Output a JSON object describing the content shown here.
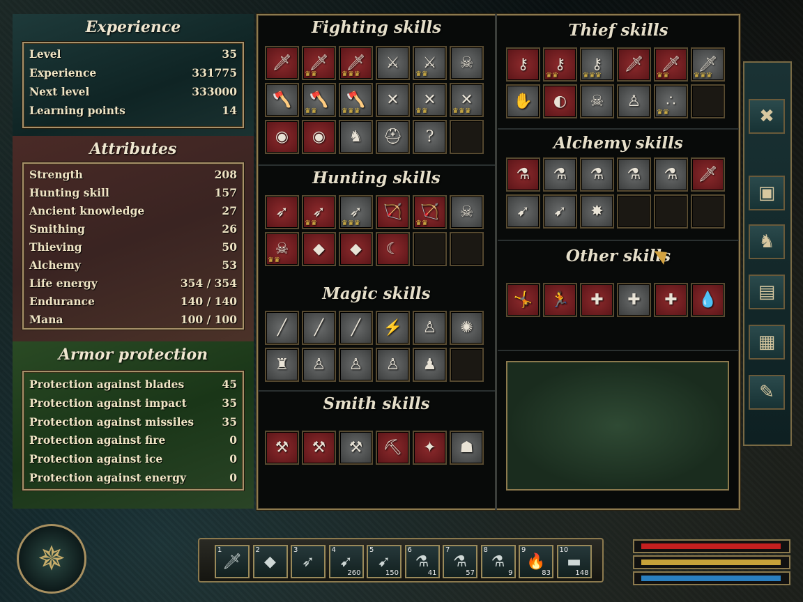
{
  "experience": {
    "title": "Experience",
    "rows": [
      {
        "label": "Level",
        "value": "35"
      },
      {
        "label": "Experience",
        "value": "331775"
      },
      {
        "label": "Next level",
        "value": "333000"
      },
      {
        "label": "Learning points",
        "value": "14"
      }
    ]
  },
  "attributes": {
    "title": "Attributes",
    "rows": [
      {
        "label": "Strength",
        "value": "208"
      },
      {
        "label": "Hunting skill",
        "value": "157"
      },
      {
        "label": "Ancient knowledge",
        "value": "27"
      },
      {
        "label": "Smithing",
        "value": "26"
      },
      {
        "label": "Thieving",
        "value": "50"
      },
      {
        "label": "Alchemy",
        "value": "53"
      },
      {
        "label": "Life energy",
        "value": "354 / 354"
      },
      {
        "label": "Endurance",
        "value": "140 / 140"
      },
      {
        "label": "Mana",
        "value": "100 / 100"
      }
    ]
  },
  "armor": {
    "title": "Armor protection",
    "rows": [
      {
        "label": "Protection against blades",
        "value": "45"
      },
      {
        "label": "Protection against impact",
        "value": "35"
      },
      {
        "label": "Protection against missiles",
        "value": "35"
      },
      {
        "label": "Protection against fire",
        "value": "0"
      },
      {
        "label": "Protection against ice",
        "value": "0"
      },
      {
        "label": "Protection against energy",
        "value": "0"
      }
    ]
  },
  "skills": {
    "fighting": {
      "title": "Fighting skills",
      "slots": [
        {
          "icon": "sword-icon",
          "glyph": "🗡",
          "state": "red",
          "crown": ""
        },
        {
          "icon": "sword-icon",
          "glyph": "🗡",
          "state": "red",
          "crown": "♛♛"
        },
        {
          "icon": "sword-icon",
          "glyph": "🗡",
          "state": "red",
          "crown": "♛♛♛"
        },
        {
          "icon": "crossed-swords-icon",
          "glyph": "⚔",
          "state": "gray",
          "crown": ""
        },
        {
          "icon": "crossed-swords-icon",
          "glyph": "⚔",
          "state": "gray",
          "crown": "♛♛"
        },
        {
          "icon": "ogre-icon",
          "glyph": "☠",
          "state": "gray",
          "crown": ""
        },
        {
          "icon": "axe-icon",
          "glyph": "🪓",
          "state": "gray",
          "crown": ""
        },
        {
          "icon": "axe-icon",
          "glyph": "🪓",
          "state": "gray",
          "crown": "♛♛"
        },
        {
          "icon": "axe-icon",
          "glyph": "🪓",
          "state": "gray",
          "crown": "♛♛♛"
        },
        {
          "icon": "crossbow-icon",
          "glyph": "✕",
          "state": "gray",
          "crown": ""
        },
        {
          "icon": "crossbow-icon",
          "glyph": "✕",
          "state": "gray",
          "crown": "♛♛"
        },
        {
          "icon": "crossbow-icon",
          "glyph": "✕",
          "state": "gray",
          "crown": "♛♛♛"
        },
        {
          "icon": "wooden-shield-icon",
          "glyph": "◉",
          "state": "red",
          "crown": ""
        },
        {
          "icon": "gold-shield-icon",
          "glyph": "◉",
          "state": "red",
          "crown": ""
        },
        {
          "icon": "knight-icon",
          "glyph": "♞",
          "state": "gray",
          "crown": ""
        },
        {
          "icon": "helmet-icon",
          "glyph": "⛑",
          "state": "gray",
          "crown": ""
        },
        {
          "icon": "question-mark-icon",
          "glyph": "?",
          "state": "gray",
          "crown": ""
        },
        {
          "icon": "empty-slot",
          "glyph": "",
          "state": "empty",
          "crown": ""
        }
      ]
    },
    "hunting": {
      "title": "Hunting skills",
      "slots": [
        {
          "icon": "bow-icon",
          "glyph": "➶",
          "state": "red",
          "crown": ""
        },
        {
          "icon": "bow-icon",
          "glyph": "➶",
          "state": "red",
          "crown": "♛♛"
        },
        {
          "icon": "bow-icon",
          "glyph": "➶",
          "state": "gray",
          "crown": "♛♛♛"
        },
        {
          "icon": "archer-icon",
          "glyph": "🏹",
          "state": "red",
          "crown": ""
        },
        {
          "icon": "archer-icon",
          "glyph": "🏹",
          "state": "red",
          "crown": "♛♛"
        },
        {
          "icon": "troll-icon",
          "glyph": "☠",
          "state": "gray",
          "crown": ""
        },
        {
          "icon": "skeleton-icon",
          "glyph": "☠",
          "state": "red",
          "crown": "♛♛"
        },
        {
          "icon": "hide-icon",
          "glyph": "◆",
          "state": "red",
          "crown": ""
        },
        {
          "icon": "green-hide-icon",
          "glyph": "◆",
          "state": "red",
          "crown": ""
        },
        {
          "icon": "claw-icon",
          "glyph": "☾",
          "state": "red",
          "crown": ""
        },
        {
          "icon": "empty-slot",
          "glyph": "",
          "state": "empty",
          "crown": ""
        },
        {
          "icon": "empty-slot",
          "glyph": "",
          "state": "empty",
          "crown": ""
        }
      ]
    },
    "magic": {
      "title": "Magic skills",
      "slots": [
        {
          "icon": "staff-icon",
          "glyph": "╱",
          "state": "gray",
          "crown": ""
        },
        {
          "icon": "staff-icon",
          "glyph": "╱",
          "state": "gray",
          "crown": ""
        },
        {
          "icon": "staff-icon",
          "glyph": "╱",
          "state": "gray",
          "crown": ""
        },
        {
          "icon": "lightning-icon",
          "glyph": "⚡",
          "state": "gray",
          "crown": ""
        },
        {
          "icon": "robe-icon",
          "glyph": "♙",
          "state": "gray",
          "crown": ""
        },
        {
          "icon": "brain-icon",
          "glyph": "✺",
          "state": "gray",
          "crown": ""
        },
        {
          "icon": "armor-icon",
          "glyph": "♜",
          "state": "gray",
          "crown": ""
        },
        {
          "icon": "robe-icon",
          "glyph": "♙",
          "state": "gray",
          "crown": ""
        },
        {
          "icon": "robe-icon",
          "glyph": "♙",
          "state": "gray",
          "crown": ""
        },
        {
          "icon": "robe-icon",
          "glyph": "♙",
          "state": "gray",
          "crown": ""
        },
        {
          "icon": "dark-robe-icon",
          "glyph": "♟",
          "state": "gray",
          "crown": ""
        },
        {
          "icon": "empty-slot",
          "glyph": "",
          "state": "empty",
          "crown": ""
        }
      ]
    },
    "smith": {
      "title": "Smith skills",
      "slots": [
        {
          "icon": "anvil-icon",
          "glyph": "⚒",
          "state": "red",
          "crown": ""
        },
        {
          "icon": "anvil-icon",
          "glyph": "⚒",
          "state": "red",
          "crown": ""
        },
        {
          "icon": "anvil-icon",
          "glyph": "⚒",
          "state": "gray",
          "crown": ""
        },
        {
          "icon": "pickaxe-icon",
          "glyph": "⛏",
          "state": "red",
          "crown": ""
        },
        {
          "icon": "sharpen-icon",
          "glyph": "✦",
          "state": "red",
          "crown": ""
        },
        {
          "icon": "golem-icon",
          "glyph": "☗",
          "state": "gray",
          "crown": ""
        }
      ]
    },
    "thief": {
      "title": "Thief skills",
      "slots": [
        {
          "icon": "key-icon",
          "glyph": "⚷",
          "state": "red",
          "crown": ""
        },
        {
          "icon": "key-icon",
          "glyph": "⚷",
          "state": "red",
          "crown": "♛♛"
        },
        {
          "icon": "key-icon",
          "glyph": "⚷",
          "state": "gray",
          "crown": "♛♛♛"
        },
        {
          "icon": "pickpocket-icon",
          "glyph": "🗡",
          "state": "red",
          "crown": ""
        },
        {
          "icon": "pickpocket-icon",
          "glyph": "🗡",
          "state": "red",
          "crown": "♛♛"
        },
        {
          "icon": "pickpocket-icon",
          "glyph": "🗡",
          "state": "gray",
          "crown": "♛♛♛"
        },
        {
          "icon": "hand-icon",
          "glyph": "✋",
          "state": "gray",
          "crown": ""
        },
        {
          "icon": "acrobat-icon",
          "glyph": "◐",
          "state": "red",
          "crown": ""
        },
        {
          "icon": "creature-icon",
          "glyph": "☠",
          "state": "gray",
          "crown": ""
        },
        {
          "icon": "figure-icon",
          "glyph": "♙",
          "state": "gray",
          "crown": ""
        },
        {
          "icon": "drops-icon",
          "glyph": "∴",
          "state": "gray",
          "crown": "♛♛"
        },
        {
          "icon": "empty-slot",
          "glyph": "",
          "state": "empty",
          "crown": ""
        }
      ]
    },
    "alchemy": {
      "title": "Alchemy skills",
      "slots": [
        {
          "icon": "red-potion-icon",
          "glyph": "⚗",
          "state": "red",
          "crown": ""
        },
        {
          "icon": "plant-potion-icon",
          "glyph": "⚗",
          "state": "gray",
          "crown": ""
        },
        {
          "icon": "potion-icon",
          "glyph": "⚗",
          "state": "gray",
          "crown": ""
        },
        {
          "icon": "potion-icon",
          "glyph": "⚗",
          "state": "gray",
          "crown": ""
        },
        {
          "icon": "ghost-potion-icon",
          "glyph": "⚗",
          "state": "gray",
          "crown": ""
        },
        {
          "icon": "poison-sword-icon",
          "glyph": "🗡",
          "state": "red",
          "crown": ""
        },
        {
          "icon": "arrow-icon",
          "glyph": "➹",
          "state": "gray",
          "crown": ""
        },
        {
          "icon": "magic-arrow-icon",
          "glyph": "➹",
          "state": "gray",
          "crown": ""
        },
        {
          "icon": "mace-icon",
          "glyph": "✸",
          "state": "gray",
          "crown": ""
        },
        {
          "icon": "empty-slot",
          "glyph": "",
          "state": "empty",
          "crown": ""
        },
        {
          "icon": "empty-slot",
          "glyph": "",
          "state": "empty",
          "crown": ""
        },
        {
          "icon": "empty-slot",
          "glyph": "",
          "state": "empty",
          "crown": ""
        }
      ]
    },
    "other": {
      "title": "Other skills",
      "slots": [
        {
          "icon": "acrobatics-icon",
          "glyph": "🤸",
          "state": "red",
          "crown": ""
        },
        {
          "icon": "sprint-icon",
          "glyph": "🏃",
          "state": "red",
          "crown": ""
        },
        {
          "icon": "regen-icon",
          "glyph": "✚",
          "state": "red",
          "crown": ""
        },
        {
          "icon": "fire-regen-icon",
          "glyph": "✚",
          "state": "gray",
          "crown": ""
        },
        {
          "icon": "health-regen-icon",
          "glyph": "✚",
          "state": "red",
          "crown": ""
        },
        {
          "icon": "mana-regen-icon",
          "glyph": "💧",
          "state": "red",
          "crown": ""
        }
      ]
    }
  },
  "tabs": [
    {
      "icon": "close-icon",
      "glyph": "✖"
    },
    {
      "icon": "inventory-chest-icon",
      "glyph": "▣"
    },
    {
      "icon": "character-icon",
      "glyph": "♞"
    },
    {
      "icon": "quest-book-icon",
      "glyph": "▤"
    },
    {
      "icon": "map-icon",
      "glyph": "▦"
    },
    {
      "icon": "journal-quill-icon",
      "glyph": "✎"
    }
  ],
  "hotbar": [
    {
      "num": "1",
      "count": "",
      "icon": "sword-icon",
      "glyph": "🗡"
    },
    {
      "num": "2",
      "count": "",
      "icon": "shield-icon",
      "glyph": "◆"
    },
    {
      "num": "3",
      "count": "",
      "icon": "bow-icon",
      "glyph": "➶"
    },
    {
      "num": "4",
      "count": "260",
      "icon": "arrow-icon",
      "glyph": "➹"
    },
    {
      "num": "5",
      "count": "150",
      "icon": "bolt-icon",
      "glyph": "➹"
    },
    {
      "num": "6",
      "count": "41",
      "icon": "red-potion-icon",
      "glyph": "⚗"
    },
    {
      "num": "7",
      "count": "57",
      "icon": "blue-potion-icon",
      "glyph": "⚗"
    },
    {
      "num": "8",
      "count": "9",
      "icon": "green-potion-icon",
      "glyph": "⚗"
    },
    {
      "num": "9",
      "count": "83",
      "icon": "torch-icon",
      "glyph": "🔥"
    },
    {
      "num": "10",
      "count": "148",
      "icon": "meat-icon",
      "glyph": "▬"
    }
  ],
  "bars": [
    {
      "name": "health",
      "color": "#c41f1f",
      "fill": 1.0
    },
    {
      "name": "endurance",
      "color": "#c7a23a",
      "fill": 1.0
    },
    {
      "name": "mana",
      "color": "#2a7fc0",
      "fill": 1.0
    }
  ]
}
